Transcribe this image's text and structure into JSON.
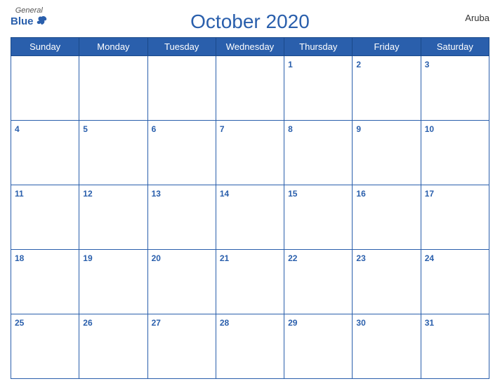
{
  "header": {
    "logo_general": "General",
    "logo_blue": "Blue",
    "title": "October 2020",
    "country": "Aruba"
  },
  "days_of_week": [
    "Sunday",
    "Monday",
    "Tuesday",
    "Wednesday",
    "Thursday",
    "Friday",
    "Saturday"
  ],
  "weeks": [
    [
      null,
      null,
      null,
      null,
      1,
      2,
      3
    ],
    [
      4,
      5,
      6,
      7,
      8,
      9,
      10
    ],
    [
      11,
      12,
      13,
      14,
      15,
      16,
      17
    ],
    [
      18,
      19,
      20,
      21,
      22,
      23,
      24
    ],
    [
      25,
      26,
      27,
      28,
      29,
      30,
      31
    ]
  ]
}
